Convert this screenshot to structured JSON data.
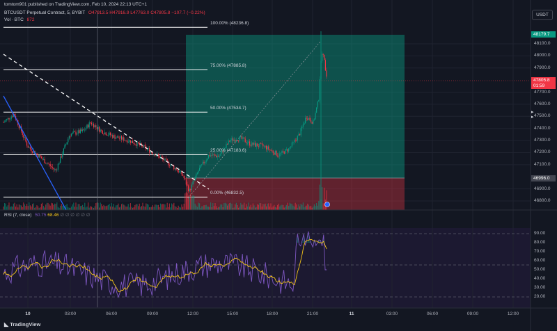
{
  "header": {
    "publisher": "tomtom901 published on TradingView.com, Feb 10, 2024 22:13 UTC+1",
    "symbol": "BTCUSDT Perpetual Contract, 5, BYBIT",
    "ohlc": {
      "o": "O47913.5",
      "h": "H47916.9",
      "l": "L47763.0",
      "c": "C47805.8",
      "change": "−107.7 (−0.22%)"
    },
    "volume_label": "Vol · BTC",
    "volume_value": "872"
  },
  "currency_button": "USDT",
  "colors": {
    "up": "#089981",
    "down": "#f23645",
    "bg": "#131722",
    "rsi": "#7e57c2",
    "rsi_ma": "#f5c518"
  },
  "fib_levels": [
    {
      "label": "100.00% (48236.8)",
      "price": 48236.8
    },
    {
      "label": "75.00% (47885.8)",
      "price": 47885.8
    },
    {
      "label": "50.00% (47534.7)",
      "price": 47534.7
    },
    {
      "label": "25.00% (47183.6)",
      "price": 47183.6
    },
    {
      "label": "0.00% (46832.5)",
      "price": 46832.5
    }
  ],
  "price_axis": [
    "48100.0",
    "48000.0",
    "47900.0",
    "47700.0",
    "47600.0",
    "47500.0",
    "47400.0",
    "47300.0",
    "47200.0",
    "47100.0",
    "46900.0",
    "46800.0"
  ],
  "price_tags": {
    "target": "48179.7",
    "current": "47805.8",
    "countdown": "01:59",
    "stop": "46996.0"
  },
  "rsi": {
    "label": "RSI (7, close)",
    "value": "50.75",
    "ma_value": "68.46",
    "placeholders": "∅ ∅ ∅ ∅ ∅ ∅",
    "axis": [
      "90.00",
      "80.00",
      "70.00",
      "60.00",
      "50.00",
      "40.00",
      "30.00",
      "20.00"
    ]
  },
  "time_axis": [
    "10",
    "03:00",
    "06:00",
    "09:00",
    "12:00",
    "15:00",
    "18:00",
    "21:00",
    "11",
    "03:00",
    "06:00",
    "09:00",
    "12:00"
  ],
  "footer_logo": "TradingView"
}
